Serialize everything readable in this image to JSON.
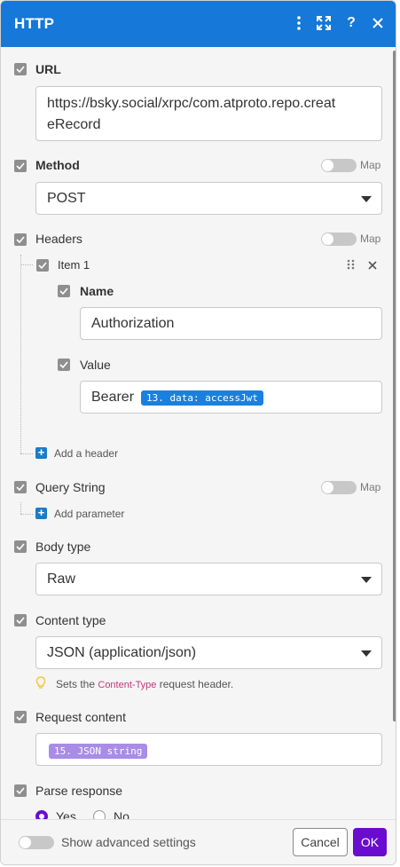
{
  "header": {
    "title": "HTTP",
    "icons": [
      "more-vertical-icon",
      "expand-icon",
      "help-icon",
      "close-icon"
    ]
  },
  "url": {
    "label": "URL",
    "value_line1": "https://bsky.social/xrpc/com.atproto.repo.creat",
    "value_line2": "eRecord"
  },
  "method": {
    "label": "Method",
    "map_label": "Map",
    "value": "POST"
  },
  "headers": {
    "label": "Headers",
    "map_label": "Map",
    "item": {
      "label": "Item 1",
      "name_label": "Name",
      "name_value": "Authorization",
      "value_label": "Value",
      "value_prefix": "Bearer",
      "value_pill": "13. data: accessJwt"
    },
    "add_label": "Add a header"
  },
  "query_string": {
    "label": "Query String",
    "map_label": "Map",
    "add_label": "Add parameter"
  },
  "body_type": {
    "label": "Body type",
    "value": "Raw"
  },
  "content_type": {
    "label": "Content type",
    "value": "JSON (application/json)",
    "hint_prefix": "Sets the",
    "hint_code": "Content-Type",
    "hint_suffix": "request header."
  },
  "request_content": {
    "label": "Request content",
    "pill": "15. JSON string"
  },
  "parse_response": {
    "label": "Parse response",
    "options": [
      "Yes",
      "No"
    ],
    "selected": "Yes"
  },
  "footer": {
    "advanced_label": "Show advanced settings",
    "cancel_label": "Cancel",
    "ok_label": "OK"
  },
  "colors": {
    "header_bg": "#1678d8",
    "pill_blue": "#1a80e0",
    "pill_purple": "#a98ce6",
    "ok_bg": "#6a0ccf",
    "hint_code": "#c7387c"
  }
}
